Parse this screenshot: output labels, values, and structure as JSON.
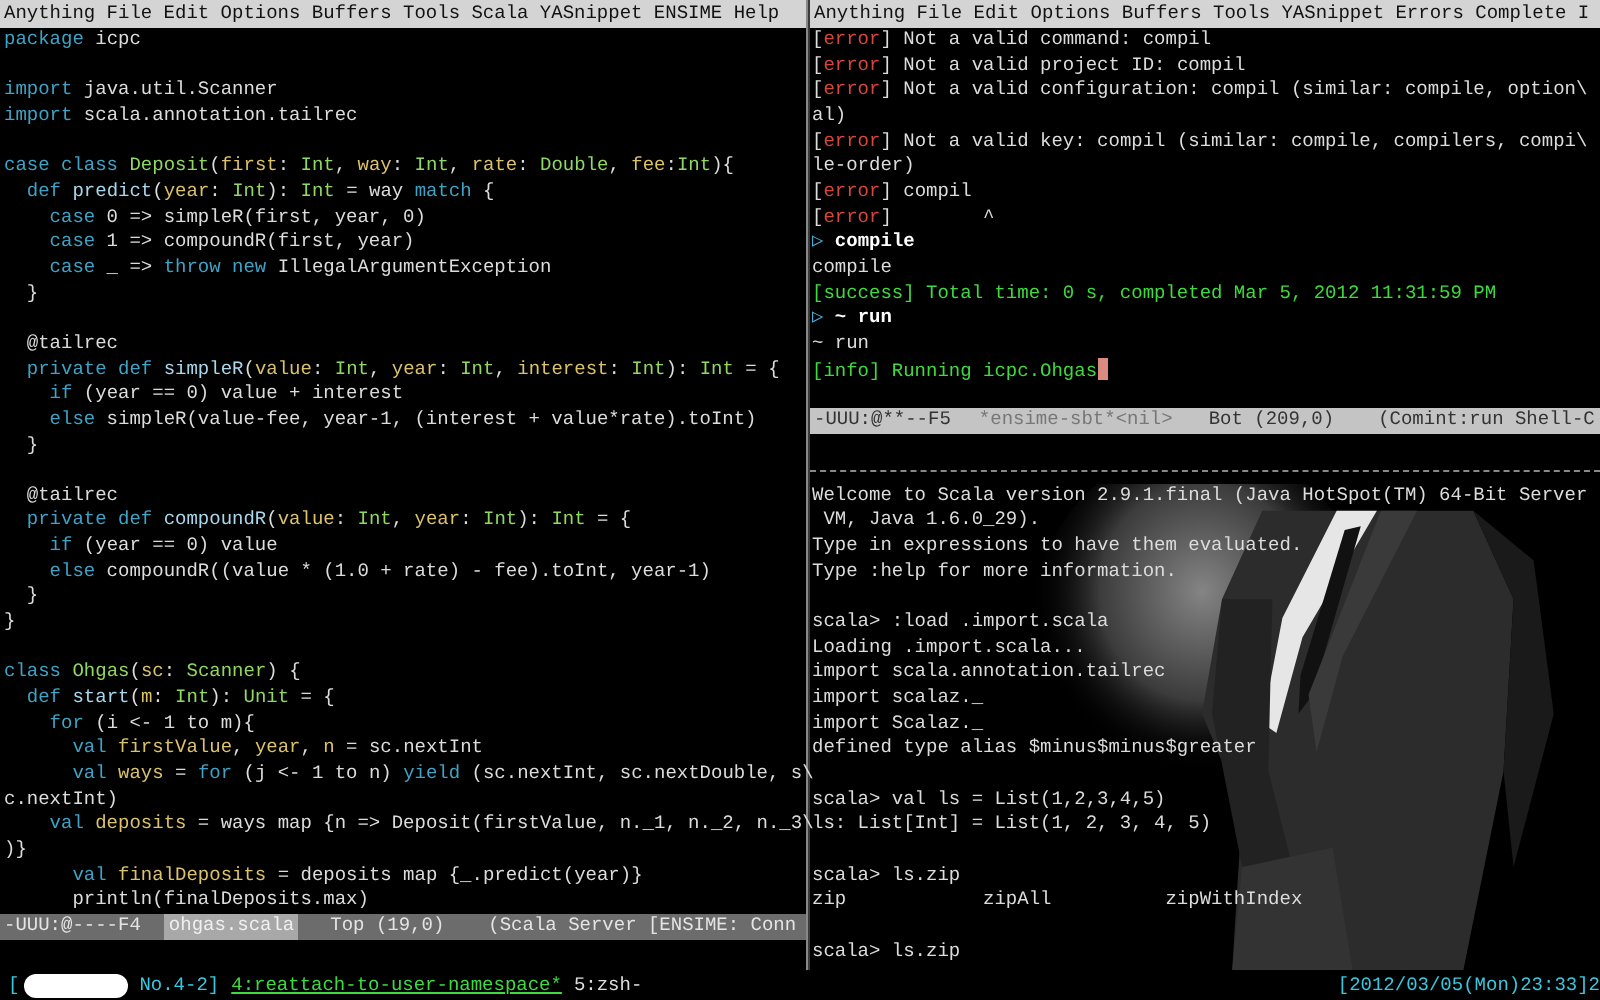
{
  "left_frame": {
    "menu": [
      "Anything",
      "File",
      "Edit",
      "Options",
      "Buffers",
      "Tools",
      "Scala",
      "YASnippet",
      "ENSIME",
      "Help"
    ],
    "lines": [
      {
        "kind": "code",
        "tokens": [
          {
            "kind": "keyword",
            "text": "package"
          },
          {
            "kind": "plain",
            "text": " icpc"
          }
        ]
      },
      {
        "kind": "blank"
      },
      {
        "kind": "code",
        "tokens": [
          {
            "kind": "keyword",
            "text": "import"
          },
          {
            "kind": "plain",
            "text": " java.util.Scanner"
          }
        ]
      },
      {
        "kind": "code",
        "tokens": [
          {
            "kind": "keyword",
            "text": "import"
          },
          {
            "kind": "plain",
            "text": " scala.annotation.tailrec"
          }
        ]
      },
      {
        "kind": "blank"
      },
      {
        "kind": "code",
        "tokens": [
          {
            "kind": "keyword",
            "text": "case class "
          },
          {
            "kind": "type",
            "text": "Deposit"
          },
          {
            "kind": "plain",
            "text": "("
          },
          {
            "kind": "param",
            "text": "first"
          },
          {
            "kind": "plain",
            "text": ": "
          },
          {
            "kind": "type",
            "text": "Int"
          },
          {
            "kind": "plain",
            "text": ", "
          },
          {
            "kind": "param",
            "text": "way"
          },
          {
            "kind": "plain",
            "text": ": "
          },
          {
            "kind": "type",
            "text": "Int"
          },
          {
            "kind": "plain",
            "text": ", "
          },
          {
            "kind": "param",
            "text": "rate"
          },
          {
            "kind": "plain",
            "text": ": "
          },
          {
            "kind": "type",
            "text": "Double"
          },
          {
            "kind": "plain",
            "text": ", "
          },
          {
            "kind": "param",
            "text": "fee"
          },
          {
            "kind": "plain",
            "text": ":"
          },
          {
            "kind": "type",
            "text": "Int"
          },
          {
            "kind": "plain",
            "text": "){"
          }
        ]
      },
      {
        "kind": "code",
        "tokens": [
          {
            "kind": "keyword",
            "text": "  def "
          },
          {
            "kind": "function",
            "text": "predict"
          },
          {
            "kind": "plain",
            "text": "("
          },
          {
            "kind": "param",
            "text": "year"
          },
          {
            "kind": "plain",
            "text": ": "
          },
          {
            "kind": "type",
            "text": "Int"
          },
          {
            "kind": "plain",
            "text": "): "
          },
          {
            "kind": "type",
            "text": "Int"
          },
          {
            "kind": "plain",
            "text": " = way "
          },
          {
            "kind": "keyword",
            "text": "match"
          },
          {
            "kind": "plain",
            "text": " {"
          }
        ]
      },
      {
        "kind": "code",
        "tokens": [
          {
            "kind": "keyword",
            "text": "    case"
          },
          {
            "kind": "plain",
            "text": " 0 => simpleR(first, year, 0)"
          }
        ]
      },
      {
        "kind": "code",
        "tokens": [
          {
            "kind": "keyword",
            "text": "    case"
          },
          {
            "kind": "plain",
            "text": " 1 => compoundR(first, year)"
          }
        ]
      },
      {
        "kind": "code",
        "tokens": [
          {
            "kind": "keyword",
            "text": "    case"
          },
          {
            "kind": "plain",
            "text": " _ => "
          },
          {
            "kind": "keyword",
            "text": "throw new"
          },
          {
            "kind": "plain",
            "text": " IllegalArgumentException"
          }
        ]
      },
      {
        "kind": "code",
        "tokens": [
          {
            "kind": "plain",
            "text": "  }"
          }
        ]
      },
      {
        "kind": "blank"
      },
      {
        "kind": "code",
        "tokens": [
          {
            "kind": "plain",
            "text": "  @tailrec"
          }
        ]
      },
      {
        "kind": "code",
        "tokens": [
          {
            "kind": "keyword",
            "text": "  private def "
          },
          {
            "kind": "function",
            "text": "simpleR"
          },
          {
            "kind": "plain",
            "text": "("
          },
          {
            "kind": "param",
            "text": "value"
          },
          {
            "kind": "plain",
            "text": ": "
          },
          {
            "kind": "type",
            "text": "Int"
          },
          {
            "kind": "plain",
            "text": ", "
          },
          {
            "kind": "param",
            "text": "year"
          },
          {
            "kind": "plain",
            "text": ": "
          },
          {
            "kind": "type",
            "text": "Int"
          },
          {
            "kind": "plain",
            "text": ", "
          },
          {
            "kind": "param",
            "text": "interest"
          },
          {
            "kind": "plain",
            "text": ": "
          },
          {
            "kind": "type",
            "text": "Int"
          },
          {
            "kind": "plain",
            "text": "): "
          },
          {
            "kind": "type",
            "text": "Int"
          },
          {
            "kind": "plain",
            "text": " = {"
          }
        ]
      },
      {
        "kind": "code",
        "tokens": [
          {
            "kind": "keyword",
            "text": "    if"
          },
          {
            "kind": "plain",
            "text": " (year == 0) value + interest"
          }
        ]
      },
      {
        "kind": "code",
        "tokens": [
          {
            "kind": "keyword",
            "text": "    else"
          },
          {
            "kind": "plain",
            "text": " simpleR(value-fee, year-1, (interest + value*rate).toInt)"
          }
        ]
      },
      {
        "kind": "code",
        "tokens": [
          {
            "kind": "plain",
            "text": "  }"
          }
        ]
      },
      {
        "kind": "blank"
      },
      {
        "kind": "code",
        "tokens": [
          {
            "kind": "plain",
            "text": "  @tailrec"
          }
        ]
      },
      {
        "kind": "code",
        "tokens": [
          {
            "kind": "keyword",
            "text": "  private def "
          },
          {
            "kind": "function",
            "text": "compoundR"
          },
          {
            "kind": "plain",
            "text": "("
          },
          {
            "kind": "param",
            "text": "value"
          },
          {
            "kind": "plain",
            "text": ": "
          },
          {
            "kind": "type",
            "text": "Int"
          },
          {
            "kind": "plain",
            "text": ", "
          },
          {
            "kind": "param",
            "text": "year"
          },
          {
            "kind": "plain",
            "text": ": "
          },
          {
            "kind": "type",
            "text": "Int"
          },
          {
            "kind": "plain",
            "text": "): "
          },
          {
            "kind": "type",
            "text": "Int"
          },
          {
            "kind": "plain",
            "text": " = {"
          }
        ]
      },
      {
        "kind": "code",
        "tokens": [
          {
            "kind": "keyword",
            "text": "    if"
          },
          {
            "kind": "plain",
            "text": " (year == 0) value"
          }
        ]
      },
      {
        "kind": "code",
        "tokens": [
          {
            "kind": "keyword",
            "text": "    else"
          },
          {
            "kind": "plain",
            "text": " compoundR((value * (1.0 + rate) - fee).toInt, year-1)"
          }
        ]
      },
      {
        "kind": "code",
        "tokens": [
          {
            "kind": "plain",
            "text": "  }"
          }
        ]
      },
      {
        "kind": "code",
        "tokens": [
          {
            "kind": "plain",
            "text": "}"
          }
        ]
      },
      {
        "kind": "blank"
      },
      {
        "kind": "code",
        "tokens": [
          {
            "kind": "keyword",
            "text": "class "
          },
          {
            "kind": "type",
            "text": "Ohgas"
          },
          {
            "kind": "plain",
            "text": "("
          },
          {
            "kind": "param",
            "text": "sc"
          },
          {
            "kind": "plain",
            "text": ": "
          },
          {
            "kind": "type",
            "text": "Scanner"
          },
          {
            "kind": "plain",
            "text": ") {"
          }
        ]
      },
      {
        "kind": "code",
        "tokens": [
          {
            "kind": "keyword",
            "text": "  def "
          },
          {
            "kind": "function",
            "text": "start"
          },
          {
            "kind": "plain",
            "text": "("
          },
          {
            "kind": "param",
            "text": "m"
          },
          {
            "kind": "plain",
            "text": ": "
          },
          {
            "kind": "type",
            "text": "Int"
          },
          {
            "kind": "plain",
            "text": "): "
          },
          {
            "kind": "type",
            "text": "Unit"
          },
          {
            "kind": "plain",
            "text": " = {"
          }
        ]
      },
      {
        "kind": "code",
        "tokens": [
          {
            "kind": "keyword",
            "text": "    for"
          },
          {
            "kind": "plain",
            "text": " (i <- 1 to m){"
          }
        ]
      },
      {
        "kind": "code",
        "tokens": [
          {
            "kind": "keyword",
            "text": "      val "
          },
          {
            "kind": "param",
            "text": "firstValue"
          },
          {
            "kind": "plain",
            "text": ", "
          },
          {
            "kind": "param",
            "text": "year"
          },
          {
            "kind": "plain",
            "text": ", "
          },
          {
            "kind": "param",
            "text": "n"
          },
          {
            "kind": "plain",
            "text": " = sc.nextInt"
          }
        ]
      },
      {
        "kind": "code",
        "tokens": [
          {
            "kind": "keyword",
            "text": "      val "
          },
          {
            "kind": "param",
            "text": "ways"
          },
          {
            "kind": "plain",
            "text": " = "
          },
          {
            "kind": "keyword",
            "text": "for"
          },
          {
            "kind": "plain",
            "text": " (j <- 1 to n) "
          },
          {
            "kind": "keyword",
            "text": "yield"
          },
          {
            "kind": "plain",
            "text": " (sc.nextInt, sc.nextDouble, s\\"
          }
        ]
      },
      {
        "kind": "code",
        "tokens": [
          {
            "kind": "plain",
            "text": "c.nextInt)"
          }
        ]
      },
      {
        "kind": "code",
        "tokens": [
          {
            "kind": "keyword",
            "text": "    val "
          },
          {
            "kind": "param",
            "text": "deposits"
          },
          {
            "kind": "plain",
            "text": " = ways map {n => Deposit(firstValue, n._1, n._2, n._3\\"
          }
        ]
      },
      {
        "kind": "code",
        "tokens": [
          {
            "kind": "plain",
            "text": ")}"
          }
        ]
      },
      {
        "kind": "code",
        "tokens": [
          {
            "kind": "keyword",
            "text": "      val "
          },
          {
            "kind": "param",
            "text": "finalDeposits"
          },
          {
            "kind": "plain",
            "text": " = deposits map {_.predict(year)}"
          }
        ]
      },
      {
        "kind": "code",
        "tokens": [
          {
            "kind": "plain",
            "text": "      println(finalDeposits.max)"
          }
        ]
      }
    ],
    "mode_line": {
      "active": false,
      "status": "-UUU:@----F4",
      "buffer": "ohgas.scala",
      "position": "Top (19,0)",
      "modes": "(Scala Server [ENSIME: Conn"
    }
  },
  "right_frame": {
    "menu": [
      "Anything",
      "File",
      "Edit",
      "Options",
      "Buffers",
      "Tools",
      "YASnippet",
      "Errors",
      "Complete",
      "I"
    ],
    "upper_lines": [
      {
        "kind": "output",
        "tokens": [
          {
            "kind": "plain",
            "text": "["
          },
          {
            "kind": "error",
            "text": "error"
          },
          {
            "kind": "plain",
            "text": "] Not a valid command: compil"
          }
        ]
      },
      {
        "kind": "output",
        "tokens": [
          {
            "kind": "plain",
            "text": "["
          },
          {
            "kind": "error",
            "text": "error"
          },
          {
            "kind": "plain",
            "text": "] Not a valid project ID: compil"
          }
        ]
      },
      {
        "kind": "output",
        "tokens": [
          {
            "kind": "plain",
            "text": "["
          },
          {
            "kind": "error",
            "text": "error"
          },
          {
            "kind": "plain",
            "text": "] Not a valid configuration: compil (similar: compile, option\\"
          }
        ]
      },
      {
        "kind": "output",
        "tokens": [
          {
            "kind": "plain",
            "text": "al)"
          }
        ]
      },
      {
        "kind": "output",
        "tokens": [
          {
            "kind": "plain",
            "text": "["
          },
          {
            "kind": "error",
            "text": "error"
          },
          {
            "kind": "plain",
            "text": "] Not a valid key: compil (similar: compile, compilers, compi\\"
          }
        ]
      },
      {
        "kind": "output",
        "tokens": [
          {
            "kind": "plain",
            "text": "le-order)"
          }
        ]
      },
      {
        "kind": "output",
        "tokens": [
          {
            "kind": "plain",
            "text": "["
          },
          {
            "kind": "error",
            "text": "error"
          },
          {
            "kind": "plain",
            "text": "] compil"
          }
        ]
      },
      {
        "kind": "output",
        "tokens": [
          {
            "kind": "plain",
            "text": "["
          },
          {
            "kind": "error",
            "text": "error"
          },
          {
            "kind": "plain",
            "text": "]        ^"
          }
        ]
      },
      {
        "kind": "output",
        "tokens": [
          {
            "kind": "prompt",
            "text": "▷"
          },
          {
            "kind": "bold",
            "text": " compile"
          }
        ]
      },
      {
        "kind": "output",
        "tokens": [
          {
            "kind": "plain",
            "text": "compile"
          }
        ]
      },
      {
        "kind": "output",
        "tokens": [
          {
            "kind": "success",
            "text": "[success] Total time: 0 s, completed Mar 5, 2012 11:31:59 PM"
          }
        ]
      },
      {
        "kind": "output",
        "tokens": [
          {
            "kind": "prompt",
            "text": "▷"
          },
          {
            "kind": "bold",
            "text": " ~ run"
          }
        ]
      },
      {
        "kind": "output",
        "tokens": [
          {
            "kind": "plain",
            "text": "~ run"
          }
        ]
      },
      {
        "kind": "output",
        "cursor": true,
        "tokens": [
          {
            "kind": "success",
            "text": "[info] Running icpc.Ohgas"
          }
        ]
      },
      {
        "kind": "blank"
      }
    ],
    "mode_line": {
      "active": true,
      "status": "-UUU:@**--F5",
      "buffer": "*ensime-sbt*<nil>",
      "position": "Bot (209,0)",
      "modes": "(Comint:run Shell-C"
    },
    "lower_lines": [
      {
        "kind": "output",
        "tokens": [
          {
            "kind": "plain",
            "text": "Welcome to Scala version 2.9.1.final (Java HotSpot(TM) 64-Bit Server"
          }
        ]
      },
      {
        "kind": "output",
        "tokens": [
          {
            "kind": "plain",
            "text": " VM, Java 1.6.0_29)."
          }
        ]
      },
      {
        "kind": "output",
        "tokens": [
          {
            "kind": "plain",
            "text": "Type in expressions to have them evaluated."
          }
        ]
      },
      {
        "kind": "output",
        "tokens": [
          {
            "kind": "plain",
            "text": "Type :help for more information."
          }
        ]
      },
      {
        "kind": "blank"
      },
      {
        "kind": "output",
        "tokens": [
          {
            "kind": "plain",
            "text": "scala> :load .import.scala"
          }
        ]
      },
      {
        "kind": "output",
        "tokens": [
          {
            "kind": "plain",
            "text": "Loading .import.scala..."
          }
        ]
      },
      {
        "kind": "output",
        "tokens": [
          {
            "kind": "plain",
            "text": "import scala.annotation.tailrec"
          }
        ]
      },
      {
        "kind": "output",
        "tokens": [
          {
            "kind": "plain",
            "text": "import scalaz._"
          }
        ]
      },
      {
        "kind": "output",
        "tokens": [
          {
            "kind": "plain",
            "text": "import Scalaz._"
          }
        ]
      },
      {
        "kind": "output",
        "tokens": [
          {
            "kind": "plain",
            "text": "defined type alias $minus$minus$greater"
          }
        ]
      },
      {
        "kind": "blank"
      },
      {
        "kind": "output",
        "tokens": [
          {
            "kind": "plain",
            "text": "scala> val ls = List(1,2,3,4,5)"
          }
        ]
      },
      {
        "kind": "output",
        "tokens": [
          {
            "kind": "plain",
            "text": "ls: List[Int] = List(1, 2, 3, 4, 5)"
          }
        ]
      },
      {
        "kind": "blank"
      },
      {
        "kind": "output",
        "tokens": [
          {
            "kind": "plain",
            "text": "scala> ls.zip"
          }
        ]
      },
      {
        "kind": "output",
        "tokens": [
          {
            "kind": "plain",
            "text": "zip            zipAll          zipWithIndex"
          }
        ]
      },
      {
        "kind": "blank"
      },
      {
        "kind": "output",
        "tokens": [
          {
            "kind": "plain",
            "text": "scala> ls.zip"
          }
        ]
      }
    ]
  },
  "status_bar": {
    "session_prefix": "[",
    "session": "No.4-2]",
    "windows": [
      {
        "label": "4:reattach-to-user-namespace*",
        "selected": true
      },
      {
        "label": "5:zsh-",
        "selected": false
      }
    ],
    "clock": "[2012/03/05(Mon)23:33]2"
  }
}
